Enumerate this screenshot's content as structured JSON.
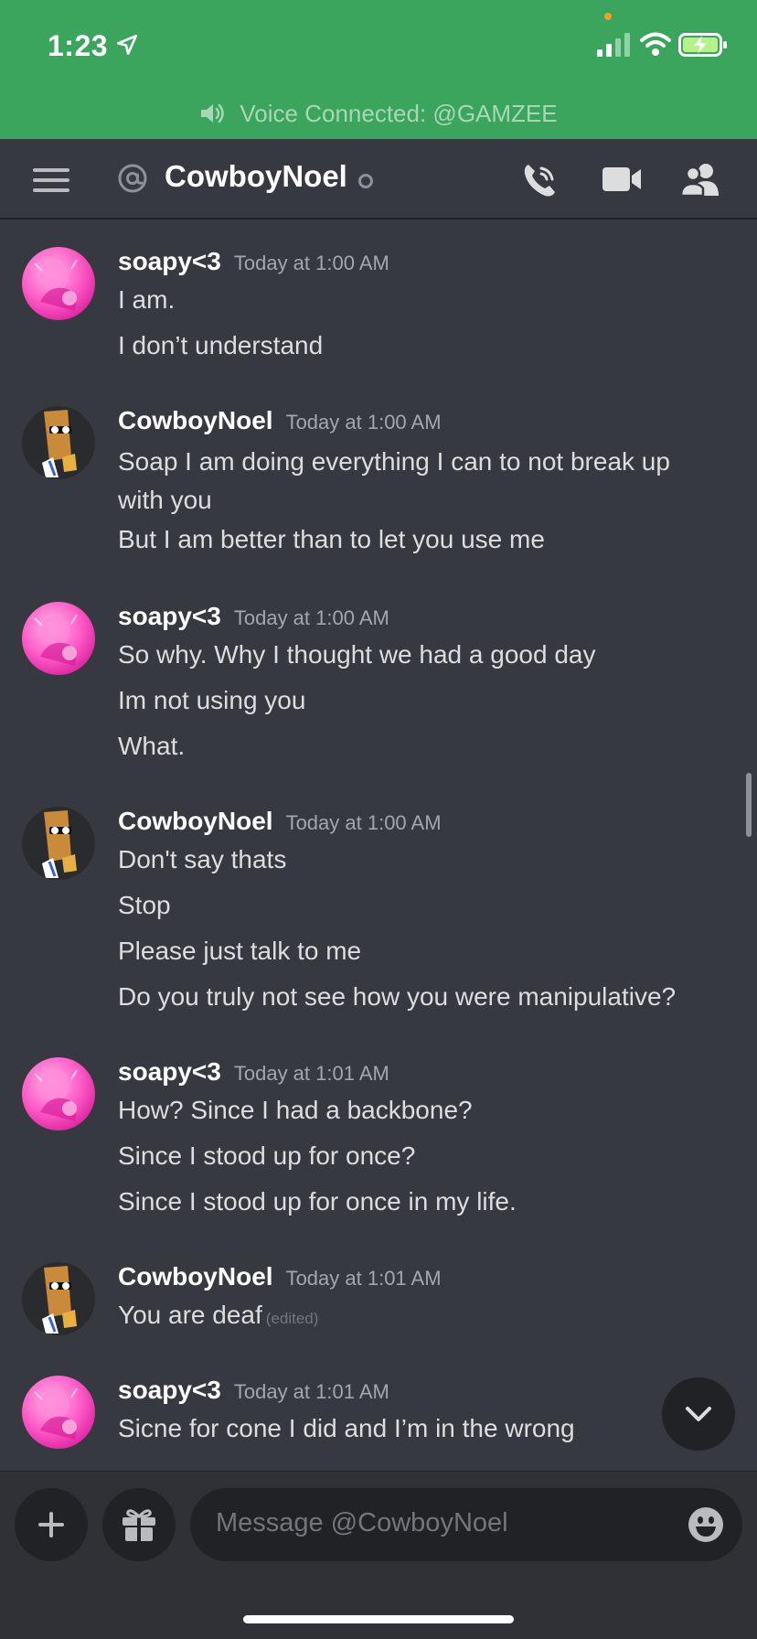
{
  "status_bar": {
    "time": "1:23"
  },
  "voice_banner": {
    "text": "Voice Connected: @GAMZEE"
  },
  "header": {
    "channel_name": "CowboyNoel"
  },
  "messages": [
    {
      "author": "soapy<3",
      "timestamp": "Today at 1:00 AM",
      "lines": [
        "I am.",
        "I don’t understand"
      ]
    },
    {
      "author": "CowboyNoel",
      "timestamp": "Today at 1:00 AM",
      "lines": [
        "Soap I am doing everything I can to not break up with you",
        "But I am better than to let you use me"
      ]
    },
    {
      "author": "soapy<3",
      "timestamp": "Today at 1:00 AM",
      "lines": [
        "So why. Why I thought we had a good day",
        "Im not using you",
        "What."
      ]
    },
    {
      "author": "CowboyNoel",
      "timestamp": "Today at 1:00 AM",
      "lines": [
        "Don't say thats",
        "Stop",
        "Please just talk to me",
        "Do you truly not see how you were manipulative?"
      ]
    },
    {
      "author": "soapy<3",
      "timestamp": "Today at 1:01 AM",
      "lines": [
        "How? Since I had a backbone?",
        "Since I stood up for once?",
        "Since I stood up for once in my life."
      ]
    },
    {
      "author": "CowboyNoel",
      "timestamp": "Today at 1:01 AM",
      "lines": [
        "You are deaf"
      ],
      "edited_label": "(edited)"
    },
    {
      "author": "soapy<3",
      "timestamp": "Today at 1:01 AM",
      "lines": [
        "Sicne for cone I did and I’m in the wrong"
      ]
    }
  ],
  "input": {
    "placeholder": "Message @CowboyNoel"
  },
  "colors": {
    "voice_green": "#3ba55d",
    "background": "#36393f",
    "input_bg": "#2f3136"
  }
}
